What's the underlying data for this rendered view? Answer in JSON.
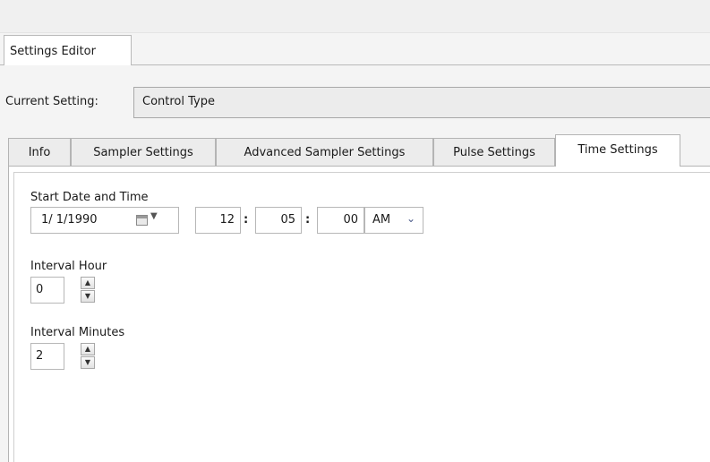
{
  "editor_tab": {
    "label": "Settings Editor"
  },
  "current_setting": {
    "label": "Current Setting:",
    "value": "Control Type"
  },
  "tabs": [
    {
      "label": "Info"
    },
    {
      "label": "Sampler Settings"
    },
    {
      "label": "Advanced Sampler Settings"
    },
    {
      "label": "Pulse Settings"
    },
    {
      "label": "Time Settings"
    }
  ],
  "active_tab": "Time Settings",
  "time_settings": {
    "start_label": "Start Date and Time",
    "date_value": "1/ 1/1990",
    "hour": "12",
    "minute": "05",
    "second": "00",
    "separator": ":",
    "ampm": "AM",
    "interval_hour_label": "Interval Hour",
    "interval_hour_value": "0",
    "interval_minutes_label": "Interval Minutes",
    "interval_minutes_value": "2"
  },
  "icons": {
    "calendar": "calendar-icon",
    "dropdown": "chevron-down-icon",
    "spin_up": "spin-up-icon",
    "spin_down": "spin-down-icon"
  }
}
